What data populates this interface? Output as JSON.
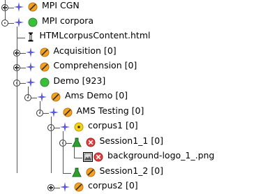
{
  "tree": {
    "nodes": [
      {
        "label": "MPI CGN",
        "indent": 0,
        "state": "collapsed",
        "status": "orange-slash",
        "node_type": "star"
      },
      {
        "label": "MPI corpora",
        "indent": 0,
        "state": "expanded",
        "status": "green",
        "node_type": "star"
      },
      {
        "label": "HTMLcorpusContent.html",
        "indent": 1,
        "state": "leaf",
        "status": "info",
        "node_type": ""
      },
      {
        "label": "Acquisition [0]",
        "indent": 1,
        "state": "collapsed",
        "status": "orange-slash",
        "node_type": "star"
      },
      {
        "label": "Comprehension [0]",
        "indent": 1,
        "state": "collapsed",
        "status": "orange-slash",
        "node_type": "star"
      },
      {
        "label": "Demo [923]",
        "indent": 1,
        "state": "expanded",
        "status": "green",
        "node_type": "star"
      },
      {
        "label": "Ams Demo [0]",
        "indent": 2,
        "state": "expanded",
        "status": "orange-slash",
        "node_type": "star"
      },
      {
        "label": "AMS Testing [0]",
        "indent": 3,
        "state": "expanded",
        "status": "orange-slash",
        "node_type": "star"
      },
      {
        "label": "corpus1 [0]",
        "indent": 4,
        "state": "expanded",
        "status": "yellow-dot",
        "node_type": "star"
      },
      {
        "label": "Session1_1 [0]",
        "indent": 5,
        "state": "expanded",
        "status": "red-x",
        "node_type": "session"
      },
      {
        "label": "background-logo_1_.png",
        "indent": 6,
        "state": "leaf",
        "status": "red-x",
        "node_type": "image"
      },
      {
        "label": "Session1_2 [0]",
        "indent": 5,
        "state": "leaf",
        "status": "orange-slash",
        "node_type": "session"
      },
      {
        "label": "corpus2 [0]",
        "indent": 4,
        "state": "collapsed",
        "status": "orange-slash",
        "node_type": "star"
      }
    ]
  },
  "colors": {
    "line": "#555555",
    "star": "#5a5ad8",
    "green": "#3bbf3b",
    "orange": "#f4a020",
    "yellow": "#f6d21a",
    "red": "#e04040",
    "session": "#2fa02f"
  }
}
